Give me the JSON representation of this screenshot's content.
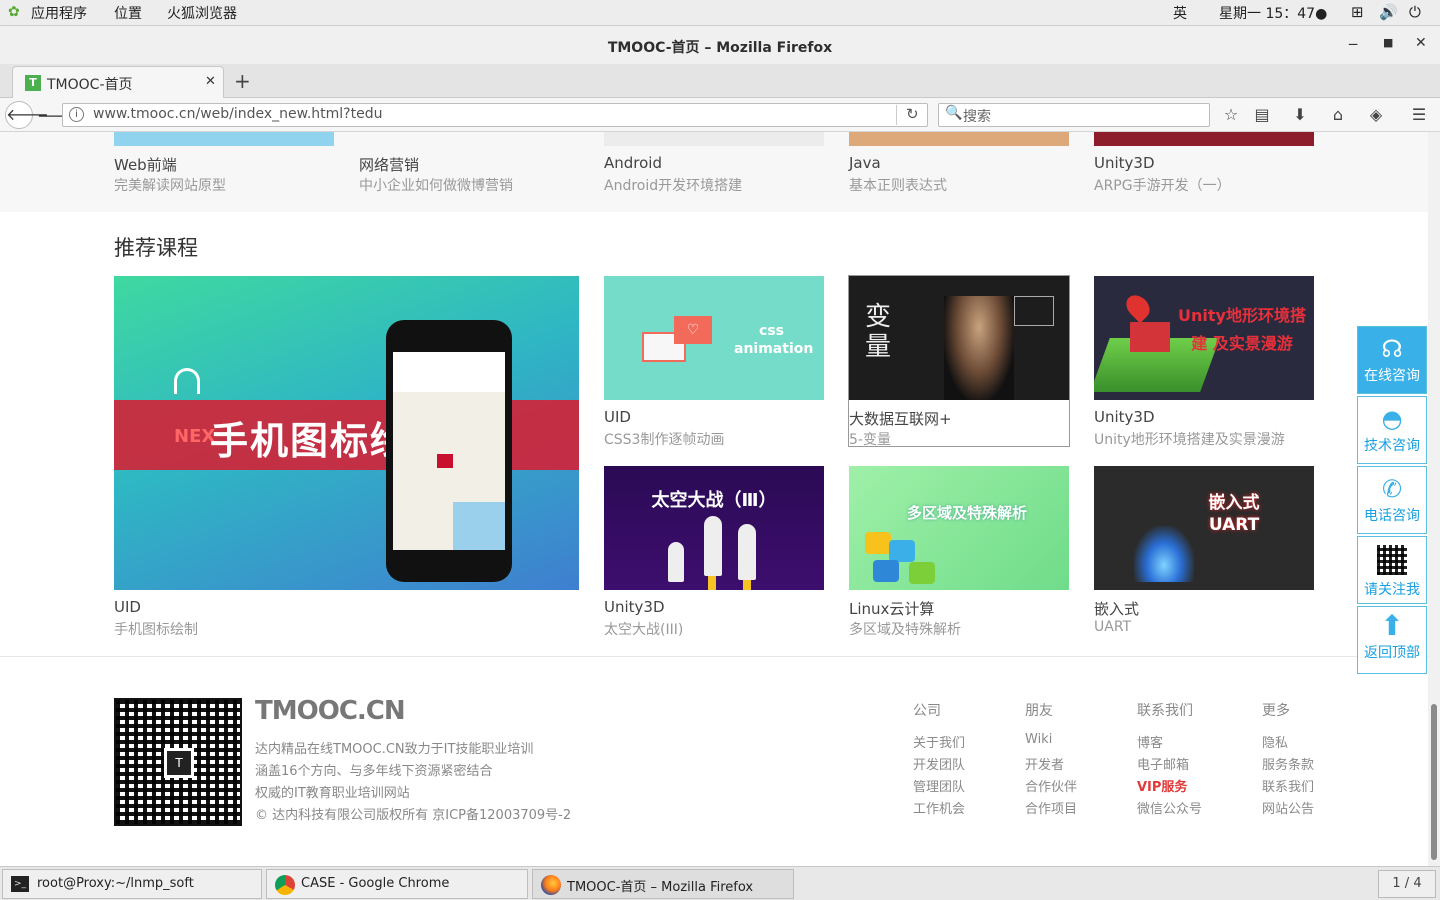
{
  "topbar": {
    "apps": "应用程序",
    "places": "位置",
    "firefox": "火狐浏览器",
    "lang": "英",
    "clock": "星期一 15：47●"
  },
  "window": {
    "title": "TMOOC-首页 – Mozilla Firefox"
  },
  "tabs": [
    {
      "label": "TMOOC-首页"
    }
  ],
  "navbar": {
    "url": "www.tmooc.cn/web/index_new.html?tedu",
    "search_placeholder": "搜索"
  },
  "top_courses": [
    {
      "title": "Web前端",
      "sub": "完美解读网站原型"
    },
    {
      "title": "网络营销",
      "sub": "中小企业如何做微博营销"
    },
    {
      "title": "Android",
      "sub": "Android开发环境搭建"
    },
    {
      "title": "Java",
      "sub": "基本正则表达式"
    },
    {
      "title": "Unity3D",
      "sub": "ARPG手游开发（一）"
    }
  ],
  "recommended": {
    "heading": "推荐课程",
    "featured": {
      "title": "UID",
      "sub": "手机图标绘制",
      "banner": "手机图标绘制",
      "brand": "NEX"
    },
    "grid": [
      {
        "title": "UID",
        "sub": "CSS3制作逐帧动画",
        "art": "css animation"
      },
      {
        "title": "大数据互联网+",
        "sub": "5-变量",
        "art": "变量"
      },
      {
        "title": "Unity3D",
        "sub": "Unity地形环境搭建及实景漫游",
        "art": "Unity地形环境搭建 及实景漫游"
      },
      {
        "title": "Unity3D",
        "sub": "太空大战(III)",
        "art": "太空大战（Ⅲ）"
      },
      {
        "title": "Linux云计算",
        "sub": "多区域及特殊解析",
        "art": "多区域及特殊解析"
      },
      {
        "title": "嵌入式",
        "sub": "UART",
        "art": "嵌入式 UART"
      }
    ]
  },
  "footer": {
    "logo": "TMOOC.CN",
    "lines": [
      "达内精品在线TMOOC.CN致力于IT技能职业培训",
      "涵盖16个方向、与多年线下资源紧密结合",
      "权威的IT教育职业培训网站",
      "© 达内科技有限公司版权所有 京ICP备12003709号-2"
    ],
    "columns": [
      {
        "heading": "公司",
        "items": [
          "关于我们",
          "开发团队",
          "管理团队",
          "工作机会"
        ]
      },
      {
        "heading": "朋友",
        "items": [
          "Wiki",
          "开发者",
          "合作伙伴",
          "合作项目"
        ]
      },
      {
        "heading": "联系我们",
        "items": [
          "博客",
          "电子邮箱",
          "VIP服务",
          "微信公众号"
        ]
      },
      {
        "heading": "更多",
        "items": [
          "隐私",
          "服务条款",
          "联系我们",
          "网站公告"
        ]
      }
    ],
    "vip_color": "#e03a3a"
  },
  "side_panel": [
    {
      "label": "在线咨询",
      "icon": "headset-icon"
    },
    {
      "label": "技术咨询",
      "icon": "qq-icon"
    },
    {
      "label": "电话咨询",
      "icon": "phone-icon"
    },
    {
      "label": "请关注我",
      "icon": "qrcode-icon"
    },
    {
      "label": "返回顶部",
      "icon": "arrow-up-icon"
    }
  ],
  "taskbar": {
    "items": [
      {
        "label": "root@Proxy:~/lnmp_soft"
      },
      {
        "label": "CASE - Google Chrome"
      },
      {
        "label": "TMOOC-首页 – Mozilla Firefox"
      }
    ],
    "workspace": "1 / 4"
  }
}
